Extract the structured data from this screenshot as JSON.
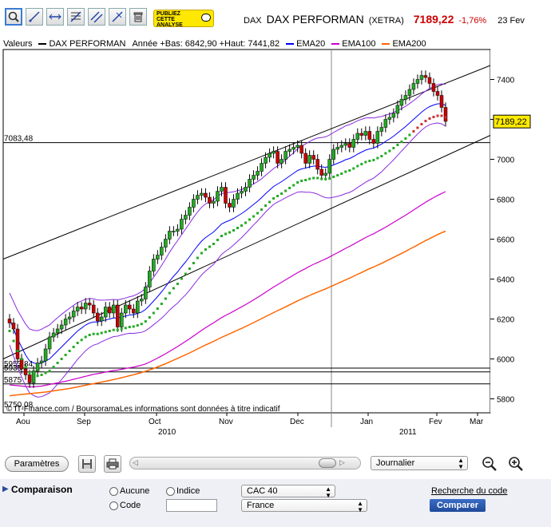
{
  "toolbar": {
    "tools": [
      {
        "name": "zoom-tool-icon",
        "active": true
      },
      {
        "name": "draw-line-icon"
      },
      {
        "name": "horizontal-line-icon"
      },
      {
        "name": "fibonacci-icon"
      },
      {
        "name": "channel-icon"
      },
      {
        "name": "trend-line-icon"
      },
      {
        "name": "trash-icon"
      }
    ],
    "promo": {
      "line1": "PUBLIEZ",
      "line2": "CETTE",
      "line3": "ANALYSE"
    }
  },
  "header": {
    "symbol": "DAX",
    "name": "DAX PERFORMAN",
    "market": "(XETRA)",
    "price": "7189,22",
    "change": "-1,76%",
    "date": "23 Fev"
  },
  "legend": {
    "valeurs": "Valeurs",
    "series_name": "DAX PERFORMAN",
    "range": "Année +Bas: 6842,90 +Haut: 7441,82",
    "ema20": "EMA20",
    "ema100": "EMA100",
    "ema200": "EMA200",
    "colors": {
      "price": "#000000",
      "ema20": "#0000ff",
      "ema100": "#cc00cc",
      "ema200": "#ff6600",
      "up": "#22aa22",
      "down": "#cc0000"
    }
  },
  "chart_data": {
    "type": "candlestick",
    "y_ticks": [
      5800,
      6000,
      6200,
      6400,
      6600,
      6800,
      7000,
      7200,
      7400
    ],
    "y_tick_labels": [
      "5800",
      "6000",
      "6200",
      "6400",
      "6600",
      "6800",
      "7000",
      "7200",
      "7400"
    ],
    "ylim": [
      5730,
      7550
    ],
    "x_month_labels": [
      "Aou",
      "Sep",
      "Oct",
      "Nov",
      "Dec",
      "Jan",
      "Fev",
      "Mar"
    ],
    "year_labels": [
      "2010",
      "2011"
    ],
    "level_labels": [
      "7083,48",
      "5953,84",
      "5935",
      "5875",
      "5750,08"
    ],
    "price_tag": "7189,22",
    "horizontal_levels": [
      7083.48,
      5953.84,
      5935,
      5875
    ],
    "source_note": "© IT-Finance.com / BoursoramaLes informations sont données à titre indicatif",
    "closes": [
      6180,
      6150,
      6000,
      5950,
      5920,
      5880,
      5940,
      5980,
      5990,
      6050,
      6110,
      6130,
      6150,
      6170,
      6200,
      6210,
      6240,
      6260,
      6250,
      6280,
      6270,
      6230,
      6190,
      6210,
      6260,
      6230,
      6270,
      6160,
      6230,
      6270,
      6250,
      6230,
      6290,
      6300,
      6360,
      6440,
      6500,
      6520,
      6560,
      6600,
      6640,
      6640,
      6650,
      6700,
      6720,
      6760,
      6800,
      6820,
      6830,
      6810,
      6780,
      6790,
      6840,
      6860,
      6780,
      6760,
      6800,
      6830,
      6840,
      6860,
      6900,
      6920,
      6940,
      6980,
      7010,
      7030,
      7040,
      6980,
      7000,
      7040,
      7050,
      7060,
      7070,
      7030,
      6980,
      7020,
      7000,
      6950,
      6920,
      6930,
      7000,
      7050,
      7060,
      7070,
      7080,
      7060,
      7100,
      7130,
      7120,
      7140,
      7100,
      7080,
      7140,
      7160,
      7200,
      7210,
      7230,
      7270,
      7300,
      7320,
      7350,
      7380,
      7400,
      7420,
      7410,
      7380,
      7340,
      7320,
      7260,
      7190
    ],
    "ema20": [
      6200,
      6150,
      6100,
      6060,
      6020,
      5990,
      5980,
      5975,
      5980,
      5990,
      6000,
      6020,
      6040,
      6060,
      6080,
      6100,
      6120,
      6140,
      6155,
      6170,
      6180,
      6185,
      6185,
      6190,
      6195,
      6200,
      6205,
      6205,
      6210,
      6215,
      6220,
      6222,
      6228,
      6235,
      6248,
      6268,
      6290,
      6312,
      6336,
      6362,
      6390,
      6414,
      6436,
      6462,
      6486,
      6512,
      6540,
      6566,
      6590,
      6608,
      6622,
      6636,
      6656,
      6676,
      6686,
      6694,
      6704,
      6716,
      6728,
      6742,
      6758,
      6774,
      6790,
      6808,
      6828,
      6846,
      6864,
      6876,
      6888,
      6902,
      6916,
      6930,
      6944,
      6952,
      6956,
      6962,
      6966,
      6966,
      6962,
      6960,
      6964,
      6972,
      6980,
      6988,
      6998,
      7004,
      7014,
      7026,
      7036,
      7046,
      7052,
      7056,
      7066,
      7076,
      7090,
      7102,
      7116,
      7132,
      7148,
      7164,
      7182,
      7200,
      7218,
      7236,
      7252,
      7264,
      7272,
      7278,
      7278,
      7270
    ],
    "ema100": [
      5870,
      5868,
      5866,
      5864,
      5862,
      5860,
      5860,
      5862,
      5864,
      5868,
      5872,
      5876,
      5880,
      5884,
      5888,
      5893,
      5898,
      5903,
      5908,
      5913,
      5918,
      5923,
      5926,
      5930,
      5934,
      5938,
      5942,
      5944,
      5948,
      5952,
      5956,
      5959,
      5964,
      5969,
      5975,
      5984,
      5994,
      6004,
      6015,
      6026,
      6038,
      6050,
      6062,
      6075,
      6088,
      6101,
      6115,
      6129,
      6143,
      6156,
      6169,
      6181,
      6194,
      6207,
      6218,
      6228,
      6239,
      6250,
      6261,
      6272,
      6284,
      6296,
      6308,
      6321,
      6334,
      6347,
      6360,
      6372,
      6384,
      6396,
      6408,
      6420,
      6432,
      6443,
      6453,
      6464,
      6474,
      6483,
      6492,
      6501,
      6511,
      6522,
      6532,
      6543,
      6554,
      6564,
      6575,
      6586,
      6597,
      6608,
      6618,
      6627,
      6638,
      6649,
      6660,
      6672,
      6684,
      6696,
      6708,
      6720,
      6733,
      6746,
      6759,
      6772,
      6785,
      6797,
      6808,
      6819,
      6829,
      6838
    ],
    "ema200": [
      5815,
      5818,
      5820,
      5822,
      5824,
      5826,
      5828,
      5830,
      5832,
      5834,
      5837,
      5840,
      5843,
      5846,
      5849,
      5852,
      5856,
      5860,
      5864,
      5868,
      5872,
      5876,
      5880,
      5884,
      5888,
      5892,
      5897,
      5901,
      5906,
      5911,
      5916,
      5921,
      5926,
      5932,
      5938,
      5945,
      5952,
      5960,
      5968,
      5976,
      5985,
      5994,
      6003,
      6012,
      6021,
      6030,
      6040,
      6050,
      6060,
      6070,
      6079,
      6088,
      6098,
      6108,
      6117,
      6126,
      6135,
      6144,
      6153,
      6162,
      6172,
      6182,
      6192,
      6202,
      6212,
      6222,
      6232,
      6242,
      6251,
      6261,
      6271,
      6281,
      6291,
      6300,
      6309,
      6318,
      6327,
      6335,
      6343,
      6351,
      6360,
      6369,
      6378,
      6387,
      6396,
      6405,
      6414,
      6424,
      6433,
      6443,
      6452,
      6460,
      6470,
      6479,
      6489,
      6499,
      6509,
      6519,
      6529,
      6539,
      6550,
      6560,
      6571,
      6582,
      6593,
      6603,
      6613,
      6623,
      6632,
      6640
    ]
  },
  "controls": {
    "parametres": "Paramètres",
    "period": "Journalier"
  },
  "comparison": {
    "title": "Comparaison",
    "aucune": "Aucune",
    "indice": "Indice",
    "code": "Code",
    "index_select": "CAC 40",
    "country_select": "France",
    "search_link": "Recherche du code",
    "compare_button": "Comparer"
  }
}
